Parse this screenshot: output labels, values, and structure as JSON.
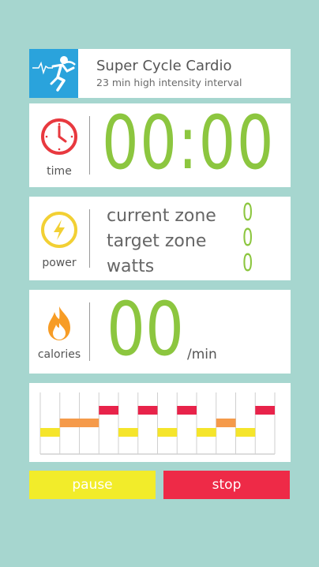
{
  "header": {
    "title": "Super Cycle Cardio",
    "subtitle": "23 min high intensity interval",
    "logo_icon": "cyclist-heartbeat-icon"
  },
  "time": {
    "label": "time",
    "value": "00:00",
    "icon": "clock-icon",
    "color": "#e8393f"
  },
  "power": {
    "label": "power",
    "icon": "lightning-icon",
    "color": "#f2d034",
    "rows": [
      {
        "label": "current zone",
        "value": "0"
      },
      {
        "label": "target zone",
        "value": "0"
      },
      {
        "label": "watts",
        "value": "0"
      }
    ]
  },
  "calories": {
    "label": "calories",
    "value": "00",
    "unit": "/min",
    "icon": "flame-icon",
    "color": "#f79c25"
  },
  "interval_chart": {
    "columns": 12,
    "zones": [
      "yellow",
      "orange",
      "orange",
      "red",
      "yellow",
      "red",
      "yellow",
      "red",
      "yellow",
      "orange",
      "yellow",
      "red"
    ],
    "zone_colors": {
      "yellow": "#f5e52b",
      "orange": "#f59a4a",
      "red": "#e8234a"
    },
    "zone_levels": {
      "yellow": 1,
      "orange": 2,
      "red": 3
    }
  },
  "controls": {
    "pause_label": "pause",
    "stop_label": "stop"
  },
  "colors": {
    "background": "#a6d6cf",
    "digits": "#8cc63f",
    "header_blue": "#2aa3dc"
  }
}
